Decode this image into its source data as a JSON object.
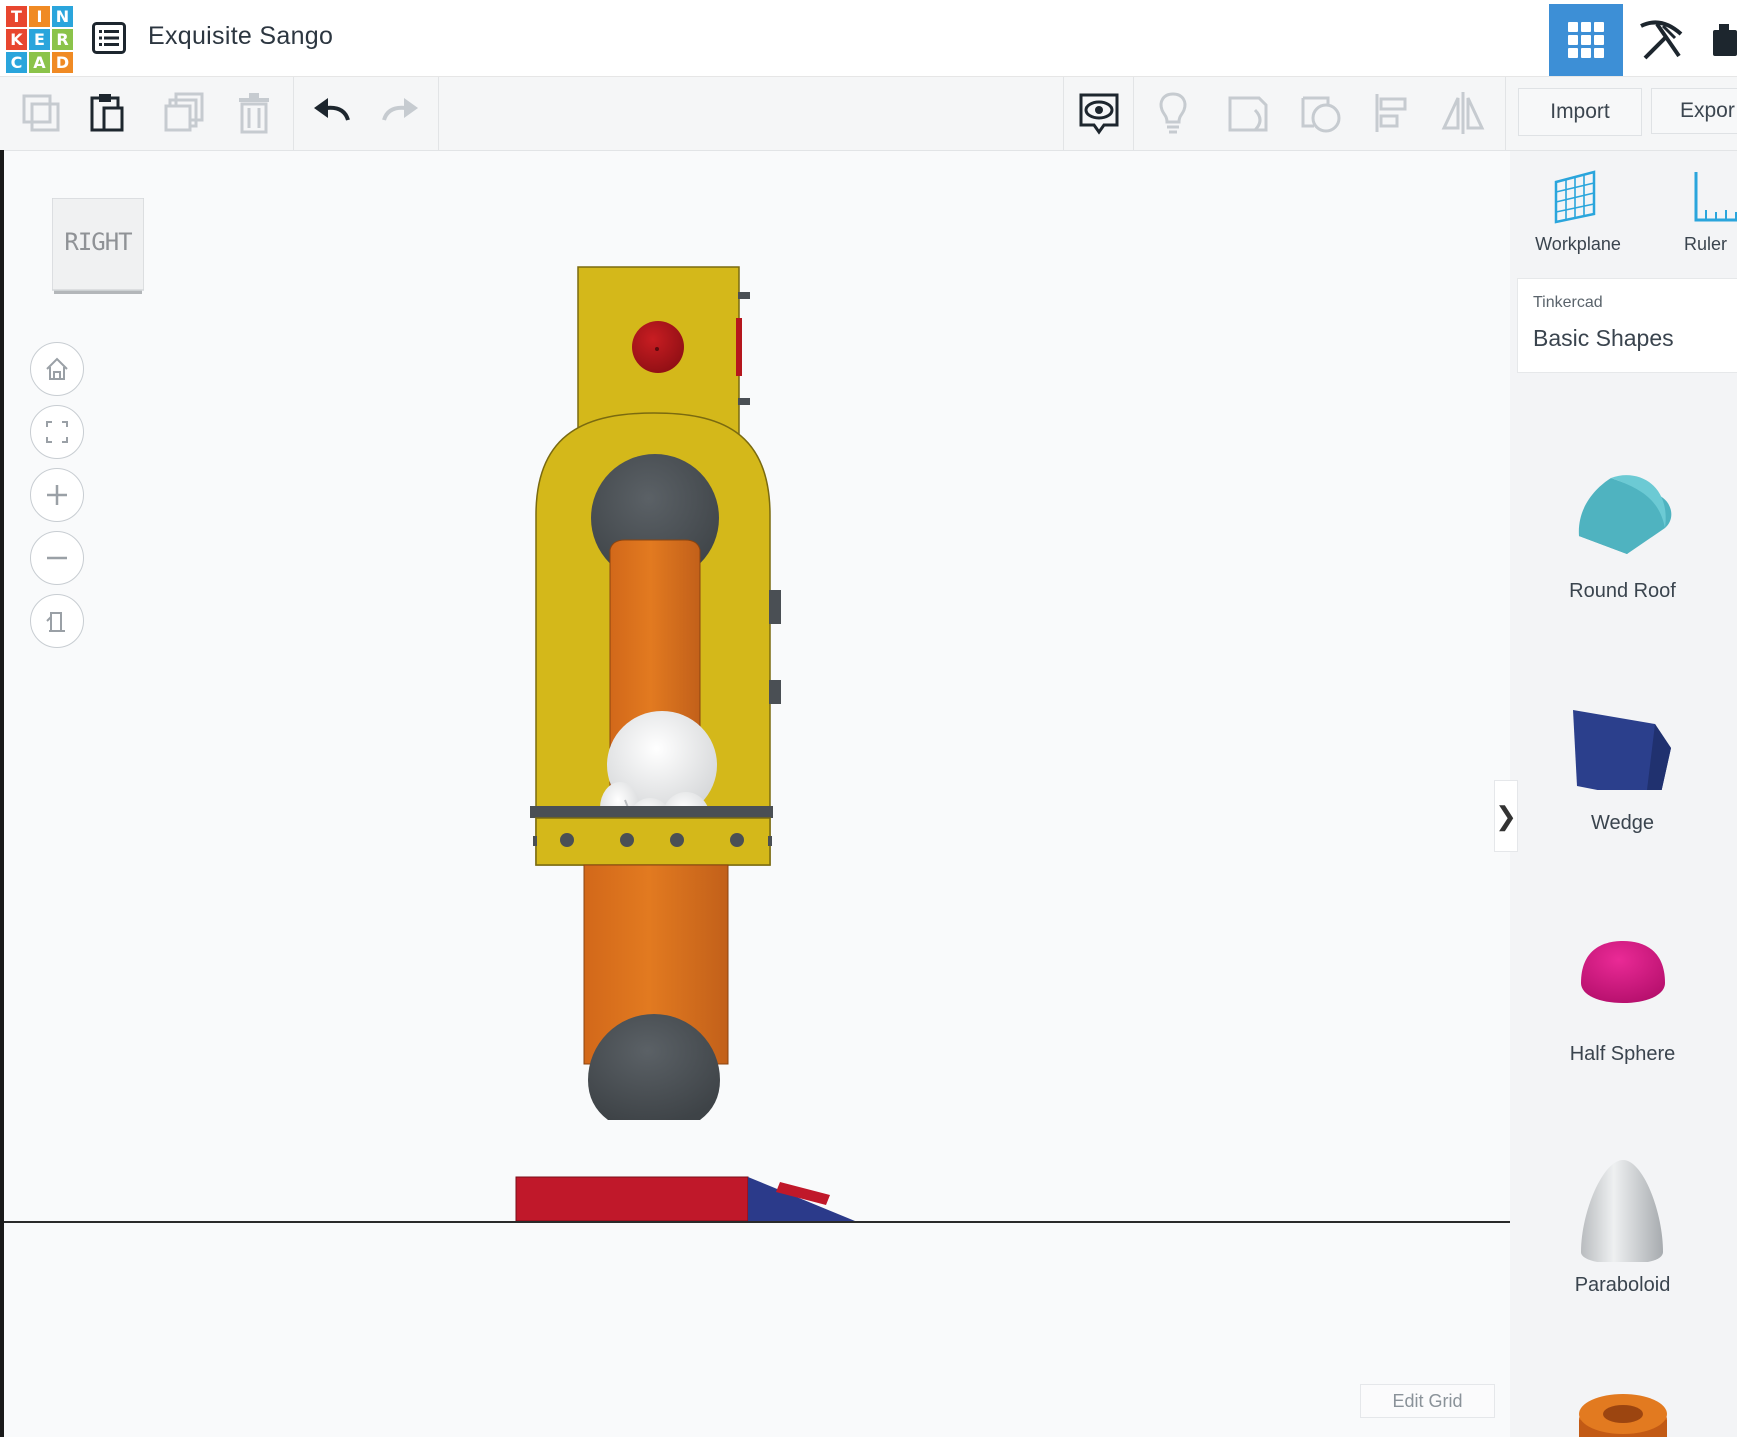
{
  "app": {
    "logo_letters": [
      "T",
      "I",
      "N",
      "K",
      "E",
      "R",
      "C",
      "A",
      "D"
    ],
    "logo_colors": [
      "#e8462f",
      "#f08a24",
      "#2aa5dc",
      "#e8462f",
      "#2aa5dc",
      "#8bc34a",
      "#2aa5dc",
      "#8bc34a",
      "#f08a24"
    ],
    "project_title": "Exquisite Sango",
    "accent": "#3d8fd6"
  },
  "header": {
    "menu_icon": "list-icon",
    "right_buttons": [
      "grid-view-icon",
      "pickaxe-icon",
      "blocks-icon"
    ]
  },
  "toolbar": {
    "left_icons": [
      "copy-icon",
      "paste-icon",
      "duplicate-icon",
      "delete-icon",
      "undo-icon",
      "redo-icon"
    ],
    "right_icons": [
      "show-all-icon",
      "hint-icon",
      "note-icon",
      "shape-outline-icon",
      "align-icon",
      "mirror-icon"
    ],
    "import_label": "Import",
    "export_label": "Expor"
  },
  "viewport": {
    "viewcube_label": "RIGHT",
    "nav_buttons": [
      "home-icon",
      "fit-view-icon",
      "zoom-in-icon",
      "zoom-out-icon",
      "perspective-icon"
    ],
    "edit_grid_label": "Edit Grid",
    "collapse_glyph": "❯"
  },
  "right_panel": {
    "tools": [
      {
        "label": "Workplane",
        "icon": "workplane-icon"
      },
      {
        "label": "Ruler",
        "icon": "ruler-icon"
      }
    ],
    "library": {
      "source": "Tinkercad",
      "name": "Basic Shapes"
    },
    "shapes": [
      {
        "label": "Round Roof",
        "color": "#4fb3c0"
      },
      {
        "label": "Wedge",
        "color": "#2b3f8c"
      },
      {
        "label": "Half Sphere",
        "color": "#d0137e"
      },
      {
        "label": "Paraboloid",
        "color": "#c9cccf"
      },
      {
        "label": "",
        "color": "#d2651a"
      }
    ]
  },
  "model_colors": {
    "body_yellow": "#d4b81a",
    "arm_orange": "#dd741d",
    "joint_gray": "#4a4f54",
    "button_red": "#b5161d",
    "base_red": "#c0182a",
    "base_blue": "#2b3a8a",
    "hand_white": "#e9eaeb"
  }
}
